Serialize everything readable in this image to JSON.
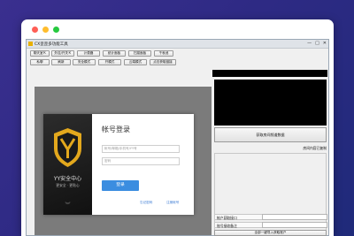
{
  "window": {
    "title": "CX歪歪多功能工具",
    "controls": [
      "—",
      "□",
      "✕"
    ]
  },
  "toolbar_row1": [
    "聊天室Ｋ",
    "外挂/开关Ｋ",
    "计费器",
    "统计面板",
    "扫描面板",
    "千秋池"
  ],
  "toolbar_row2": [
    "私聊",
    "刷新",
    "安全模式",
    "开模式",
    "云端模式",
    "点击获取链接"
  ],
  "right_panel": {
    "get_room_button": "获取房间频道数据",
    "status_text": "房间内容已复制",
    "field_labels": [
      "帐户获取接口",
      "账号接收备注"
    ],
    "bottom_button": "全部一键导入获取账户"
  },
  "login_dialog": {
    "brand_name": "YY安全中心",
    "slogan": "更安全 · 更贴心",
    "heading": "帐号登录",
    "account_placeholder": "帐号/邮箱/手机号/YY号",
    "password_placeholder": "密码",
    "login_button": "登录",
    "forgot_link": "忘记密码",
    "register_link": "注册帐号"
  },
  "colors": {
    "background_gradient_start": "#3a2f8f",
    "login_button": "#3b8de0",
    "traffic_red": "#ff5f56",
    "traffic_yellow": "#ffbd2e",
    "traffic_green": "#27c93f",
    "brand_gold": "#e3a81d"
  }
}
